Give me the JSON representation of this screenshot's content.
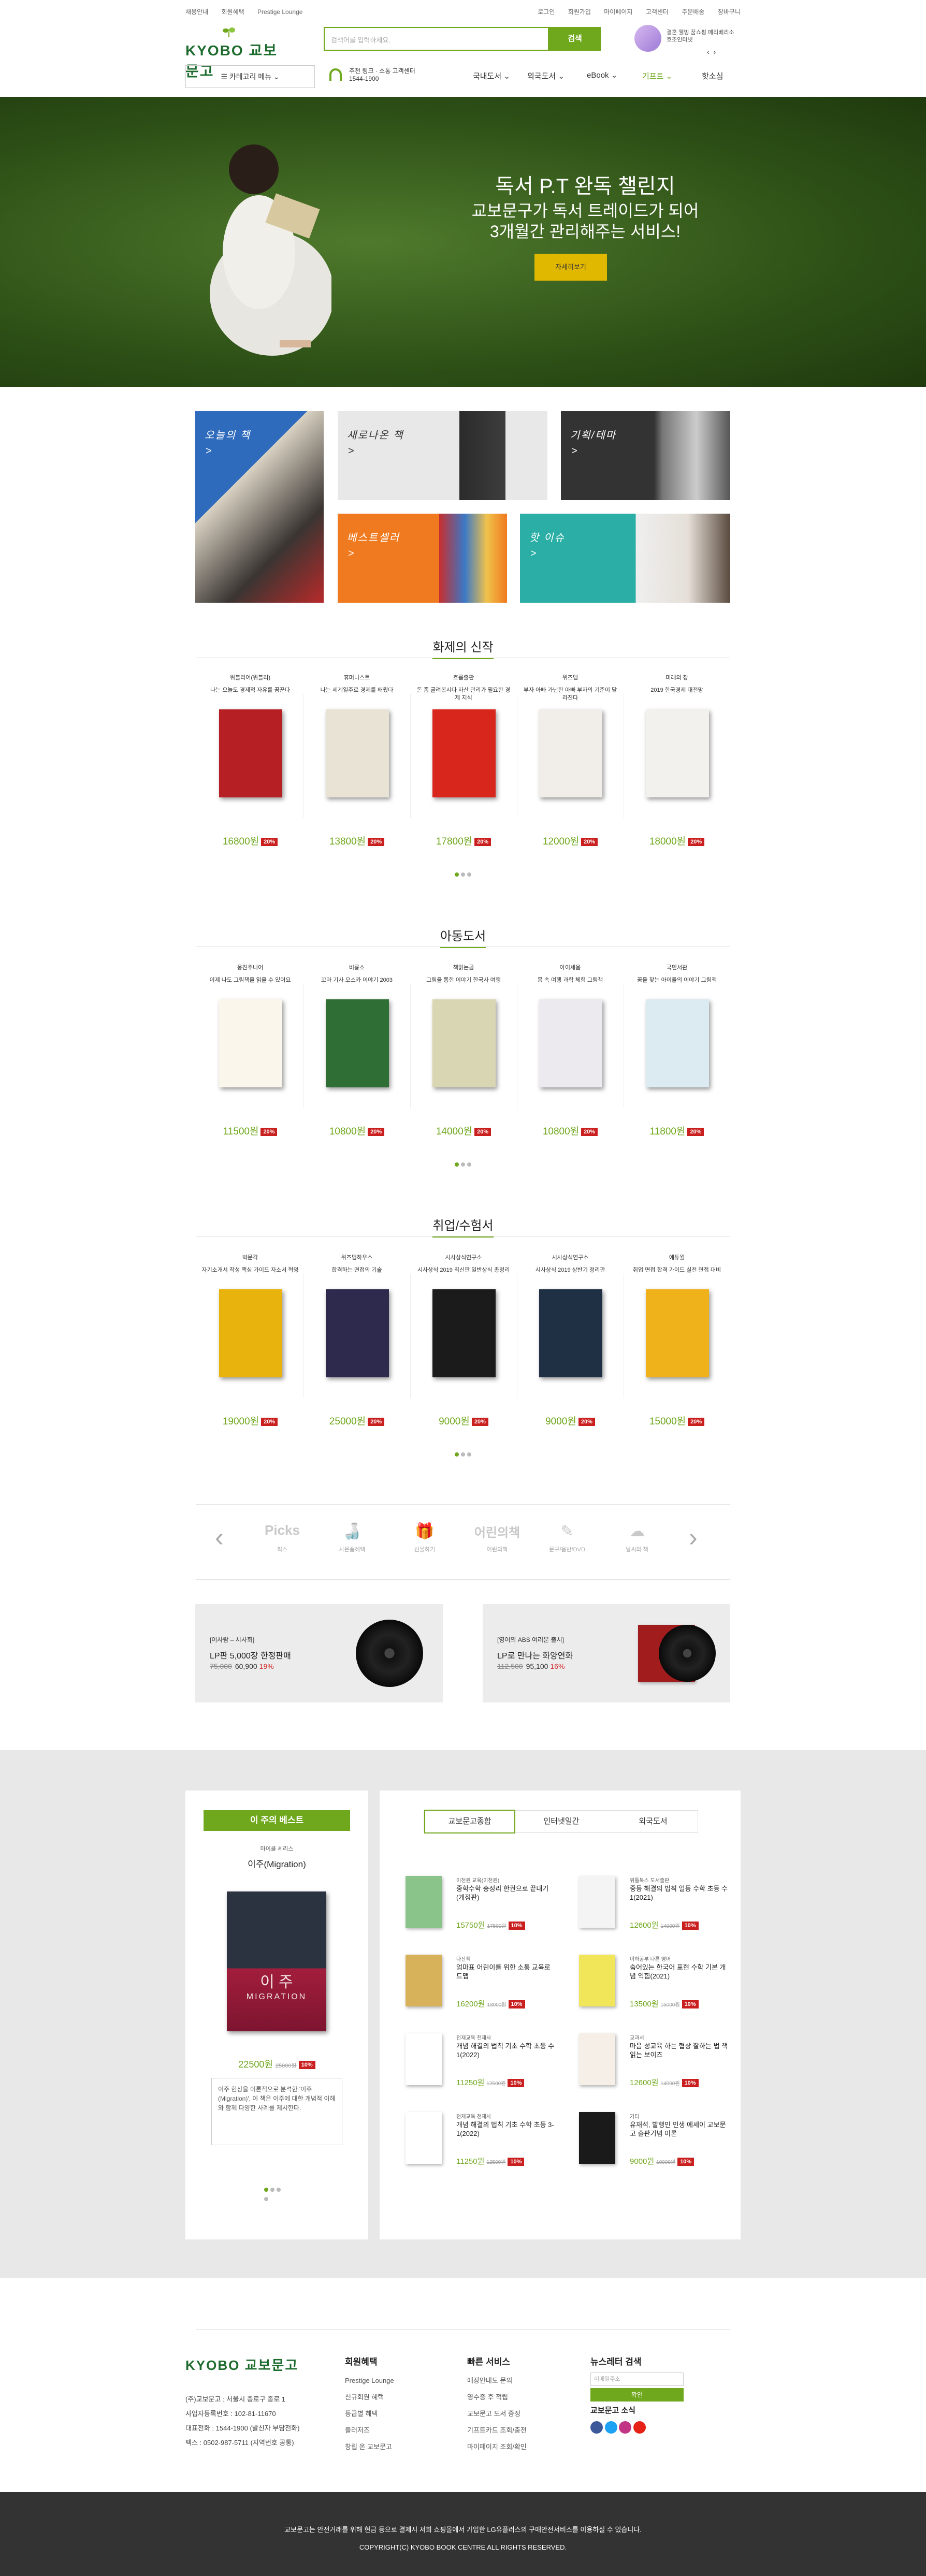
{
  "util_left": [
    "채용안내",
    "회원혜택",
    "Prestige Lounge"
  ],
  "util_right": [
    "로그인",
    "회원가입",
    "마이페이지",
    "고객센터",
    "주문배송",
    "장바구니"
  ],
  "logo_text": "KYOBO 교보문고",
  "search": {
    "placeholder": "검색어를 입력하세요.",
    "button": "검색"
  },
  "promo": {
    "text": "결혼 웰빙 꿈쇼핑 메리베리소호조인터넷",
    "prev": "‹",
    "next": "›"
  },
  "category_button": "카테고리 메뉴",
  "cs": {
    "label": "추천 링크 · 소통 고객센터",
    "phone": "1544-1900"
  },
  "menu": [
    "국내도서",
    "외국도서",
    "eBook",
    "기프트",
    "핫소심"
  ],
  "hero": {
    "line1": "독서 P.T 완독 챌린지",
    "line2": "교보문구가 독서 트레이드가 되어",
    "line3": "3개월간 관리해주는 서비스!",
    "button": "자세히보기"
  },
  "tiles": [
    {
      "label": "오늘의 책",
      "arrow": ">"
    },
    {
      "label": "새로나온 책",
      "arrow": ">"
    },
    {
      "label": "기획/테마",
      "arrow": ">"
    },
    {
      "label": "베스트셀러",
      "arrow": ">"
    },
    {
      "label": "핫 이슈",
      "arrow": ">"
    }
  ],
  "sections": [
    {
      "title": "화제의 신작",
      "books": [
        {
          "pub": "위블리어(위블리)",
          "title": "나는 오늘도 경제적 자유를 꿈꾼다",
          "price": "16800원",
          "discount": "20%",
          "cover": "#b61f23"
        },
        {
          "pub": "휴머니스트",
          "title": "나는 세계일주로 경제를 배웠다",
          "price": "13800원",
          "discount": "20%",
          "cover": "#e9e3d6"
        },
        {
          "pub": "흐름출판",
          "title": "돈 좀 굴려봅시다 자산 관리가 필요한 경제 지식",
          "price": "17800원",
          "discount": "20%",
          "cover": "#d9261c"
        },
        {
          "pub": "위즈덤",
          "title": "부자 아빠 가난한 아빠 부자의 기준이 달라진다",
          "price": "12000원",
          "discount": "20%",
          "cover": "#f1eee9"
        },
        {
          "pub": "미래의 창",
          "title": "2019 한국경제 대전망",
          "price": "18000원",
          "discount": "20%",
          "cover": "#f3f1ee"
        }
      ]
    },
    {
      "title": "아동도서",
      "books": [
        {
          "pub": "웅진주니어",
          "title": "이제 나도 그림책을 읽을 수 있어요",
          "price": "11500원",
          "discount": "20%",
          "cover": "#fbf6ec"
        },
        {
          "pub": "비룡소",
          "title": "꼬마 기사 오스카 이야기 2003",
          "price": "10800원",
          "discount": "20%",
          "cover": "#2f6e35"
        },
        {
          "pub": "책읽는곰",
          "title": "그림을 통한 이야기 한국사 여행",
          "price": "14000원",
          "discount": "20%",
          "cover": "#d9d7b3"
        },
        {
          "pub": "아이세움",
          "title": "몸 속 여행 과학 체험 그림책",
          "price": "10800원",
          "discount": "20%",
          "cover": "#ece9ef"
        },
        {
          "pub": "국민서관",
          "title": "꿈을 찾는 아이들의 이야기 그림책",
          "price": "11800원",
          "discount": "20%",
          "cover": "#dceaf1"
        }
      ]
    },
    {
      "title": "취업/수험서",
      "books": [
        {
          "pub": "박문각",
          "title": "자기소개서 작성 핵심 가이드 자소서 혁명",
          "price": "19000원",
          "discount": "20%",
          "cover": "#e8b30c"
        },
        {
          "pub": "위즈덤하우스",
          "title": "합격하는 면접의 기술",
          "price": "25000원",
          "discount": "20%",
          "cover": "#2e2a4d"
        },
        {
          "pub": "시사상식연구소",
          "title": "시사상식 2019 최신판 일반상식 총정리",
          "price": "9000원",
          "discount": "20%",
          "cover": "#1b1b1b"
        },
        {
          "pub": "시사상식연구소",
          "title": "시사상식 2019 상반기 정리판",
          "price": "9000원",
          "discount": "20%",
          "cover": "#1f2f44"
        },
        {
          "pub": "에듀윌",
          "title": "취업 면접 합격 가이드 실전 면접 대비",
          "price": "15000원",
          "discount": "20%",
          "cover": "#f0b21a"
        }
      ]
    }
  ],
  "icon_strip": {
    "prev": "‹",
    "next": "›",
    "items": [
      {
        "icon": "Picks",
        "label": "픽스"
      },
      {
        "icon": "🍶",
        "label": "사은품혜택"
      },
      {
        "icon": "🎁",
        "label": "선물하기"
      },
      {
        "icon": "어린의책",
        "label": "어린의책"
      },
      {
        "icon": "✎",
        "label": "문구/음반/DVD"
      },
      {
        "icon": "☁",
        "label": "날씨와 책"
      }
    ]
  },
  "lp": [
    {
      "tag": "[이사람 – 시사회]",
      "title": "LP판 5,000장 한정판매",
      "orig": "75,000",
      "price": "60,900",
      "rate": "19%"
    },
    {
      "tag": "[영어의 ABS 여러분 출시]",
      "title": "LP로 만나는 화양연화",
      "orig": "112,500",
      "price": "95,100",
      "rate": "16%"
    }
  ],
  "weekly": {
    "header": "이 주의 베스트",
    "author": "마이클 셰리스",
    "title": "이주(Migration)",
    "cover_title": "이 주",
    "cover_sub": "MIGRATION",
    "price": "22500원",
    "orig": "25000원",
    "discount": "10%",
    "desc": "이주 현상을 이론적으로 분석한 '이주(Migration)', 이 책은 이주에 대한 개념적 이해와 함께 다양한 사례를 제시한다."
  },
  "best": {
    "tabs": [
      "교보문고종합",
      "인터넷일간",
      "외국도서"
    ],
    "items": [
      {
        "pub": "이천원 교육(이천원)",
        "title": "중학수학 총정리 한권으로 끝내기(개정판)",
        "price": "15750원",
        "orig": "17500원",
        "discount": "10%",
        "cover": "#8ac48a"
      },
      {
        "pub": "위틀북스 도서출판",
        "title": "중등 해결의 법칙 일등 수학 초등 수 1(2021)",
        "price": "12600원",
        "orig": "14000원",
        "discount": "10%",
        "cover": "#f4f4f4"
      },
      {
        "pub": "다산책",
        "title": "엄마표 어린이를 위한 소통 교육로드맵",
        "price": "16200원",
        "orig": "18000원",
        "discount": "10%",
        "cover": "#d8b25a"
      },
      {
        "pub": "이하공부 다른 영어",
        "title": "숨어있는 한국어 표현 수학 기본 개념 익힘(2021)",
        "price": "13500원",
        "orig": "15000원",
        "discount": "10%",
        "cover": "#f1e65a"
      },
      {
        "pub": "천재교육 천재사",
        "title": "개념 해결의 법칙 기초 수학 초등 수 1(2022)",
        "price": "11250원",
        "orig": "12500원",
        "discount": "10%",
        "cover": "#ffffff"
      },
      {
        "pub": "교과서",
        "title": "마음 성교육 하는 협상 잘하는 법 책 읽는 보이즈",
        "price": "12600원",
        "orig": "14000원",
        "discount": "10%",
        "cover": "#f5efe7"
      },
      {
        "pub": "천재교육 천재사",
        "title": "개념 해결의 법칙 기초 수학 초등 3-1(2022)",
        "price": "11250원",
        "orig": "12500원",
        "discount": "10%",
        "cover": "#ffffff"
      },
      {
        "pub": "기타",
        "title": "유재석, 발행인 인생 에세이 교보문고 출판기념 이론",
        "price": "9000원",
        "orig": "10000원",
        "discount": "10%",
        "cover": "#1a1a1a"
      }
    ]
  },
  "footer": {
    "logo": "KYOBO 교보문고",
    "company": [
      "(주)교보문고 : 서울시 종로구 종로 1",
      "사업자등록번호 : 102-81-11670",
      "대표전화 : 1544-1900 (발신자 부담전화)",
      "팩스 : 0502-987-5711 (지역번호 공통)"
    ],
    "col1_title": "회원혜택",
    "col1": [
      "Prestige Lounge",
      "신규회원 혜택",
      "등급별 혜택",
      "플러저즈",
      "창립 온 교보문고"
    ],
    "col2_title": "빠른 서비스",
    "col2": [
      "매장안내도 문의",
      "영수증 후 적립",
      "교보문고 도서 증정",
      "기프트카드 조회/충전",
      "마이페이지 조회/확인"
    ],
    "news_title": "뉴스레터 검색",
    "news_placeholder": "이메일주소",
    "news_button": "확인",
    "social_title": "교보문고 소식",
    "copy1": "교보문고는 안전거래를 위해 현금 등으로 결제시 저희 쇼핑몰에서 가입한 LG유플러스의 구매안전서비스를 이용하실 수 있습니다.",
    "copy2": "COPYRIGHT(C) KYOBO BOOK CENTRE ALL RIGHTS RESERVED."
  },
  "colors": {
    "brand_green": "#6fa71d",
    "sale_red": "#c91f1f",
    "hero_yellow": "#e1b800"
  }
}
